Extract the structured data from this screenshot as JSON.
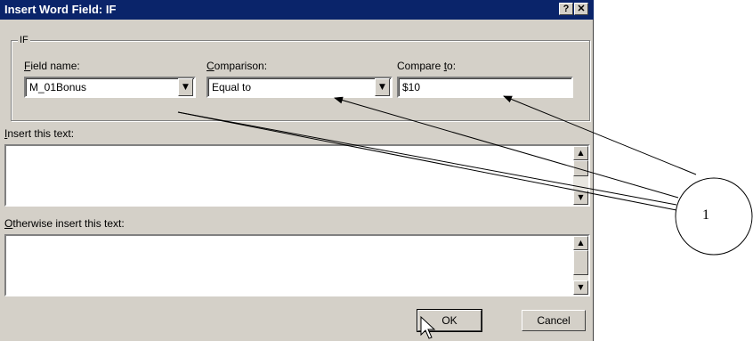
{
  "window": {
    "title": "Insert Word Field: IF",
    "help_glyph": "?",
    "close_glyph": "✕"
  },
  "group": {
    "label": "IF"
  },
  "field_name": {
    "label_key": "F",
    "label_rest": "ield name:",
    "value": "M_01Bonus"
  },
  "comparison": {
    "label_key": "C",
    "label_rest": "omparison:",
    "value": "Equal to"
  },
  "compare_to": {
    "label_pre": "Compare ",
    "label_key": "t",
    "label_rest": "o:",
    "value": "$10"
  },
  "insert_text": {
    "label_key": "I",
    "label_rest": "nsert this text:",
    "value": ""
  },
  "otherwise_text": {
    "label_key": "O",
    "label_rest": "therwise insert this text:",
    "value": ""
  },
  "buttons": {
    "ok": "OK",
    "cancel": "Cancel"
  },
  "callout": {
    "number": "1"
  },
  "icons": {
    "dropdown": "chevron-down-icon",
    "scroll_up": "scroll-up-icon",
    "scroll_down": "scroll-down-icon",
    "cursor": "mouse-pointer-icon"
  }
}
